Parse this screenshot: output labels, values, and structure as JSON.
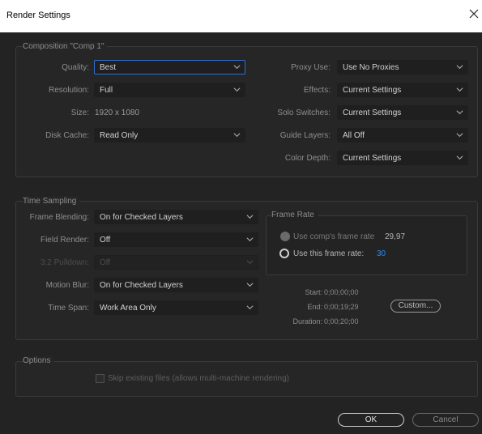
{
  "window": {
    "title": "Render Settings"
  },
  "composition": {
    "group_label": "Composition \"Comp 1\"",
    "quality": {
      "label": "Quality:",
      "value": "Best"
    },
    "resolution": {
      "label": "Resolution:",
      "value": "Full"
    },
    "size": {
      "label": "Size:",
      "value": "1920 x 1080"
    },
    "disk_cache": {
      "label": "Disk Cache:",
      "value": "Read Only"
    },
    "proxy_use": {
      "label": "Proxy Use:",
      "value": "Use No Proxies"
    },
    "effects": {
      "label": "Effects:",
      "value": "Current Settings"
    },
    "solo_switches": {
      "label": "Solo Switches:",
      "value": "Current Settings"
    },
    "guide_layers": {
      "label": "Guide Layers:",
      "value": "All Off"
    },
    "color_depth": {
      "label": "Color Depth:",
      "value": "Current Settings"
    }
  },
  "time_sampling": {
    "group_label": "Time Sampling",
    "frame_blending": {
      "label": "Frame Blending:",
      "value": "On for Checked Layers"
    },
    "field_render": {
      "label": "Field Render:",
      "value": "Off"
    },
    "pulldown": {
      "label": "3:2 Pulldown:",
      "value": "Off"
    },
    "motion_blur": {
      "label": "Motion Blur:",
      "value": "On for Checked Layers"
    },
    "time_span": {
      "label": "Time Span:",
      "value": "Work Area Only"
    },
    "frame_rate": {
      "group_label": "Frame Rate",
      "use_comp_label": "Use comp's frame rate",
      "use_comp_value": "29,97",
      "use_this_label": "Use this frame rate:",
      "use_this_value": "30",
      "selected": "use_this"
    },
    "start": {
      "label": "Start:",
      "value": "0;00;00;00"
    },
    "end": {
      "label": "End:",
      "value": "0;00;19;29"
    },
    "duration": {
      "label": "Duration:",
      "value": "0;00;20;00"
    },
    "custom_button": "Custom..."
  },
  "options": {
    "group_label": "Options",
    "skip_existing": {
      "label": "Skip existing files (allows multi-machine rendering)",
      "checked": false
    }
  },
  "footer": {
    "ok_label": "OK",
    "cancel_label": "Cancel"
  },
  "colors": {
    "accent": "#2f6fd2",
    "background": "#232323",
    "link_blue": "#2f8cf0"
  }
}
